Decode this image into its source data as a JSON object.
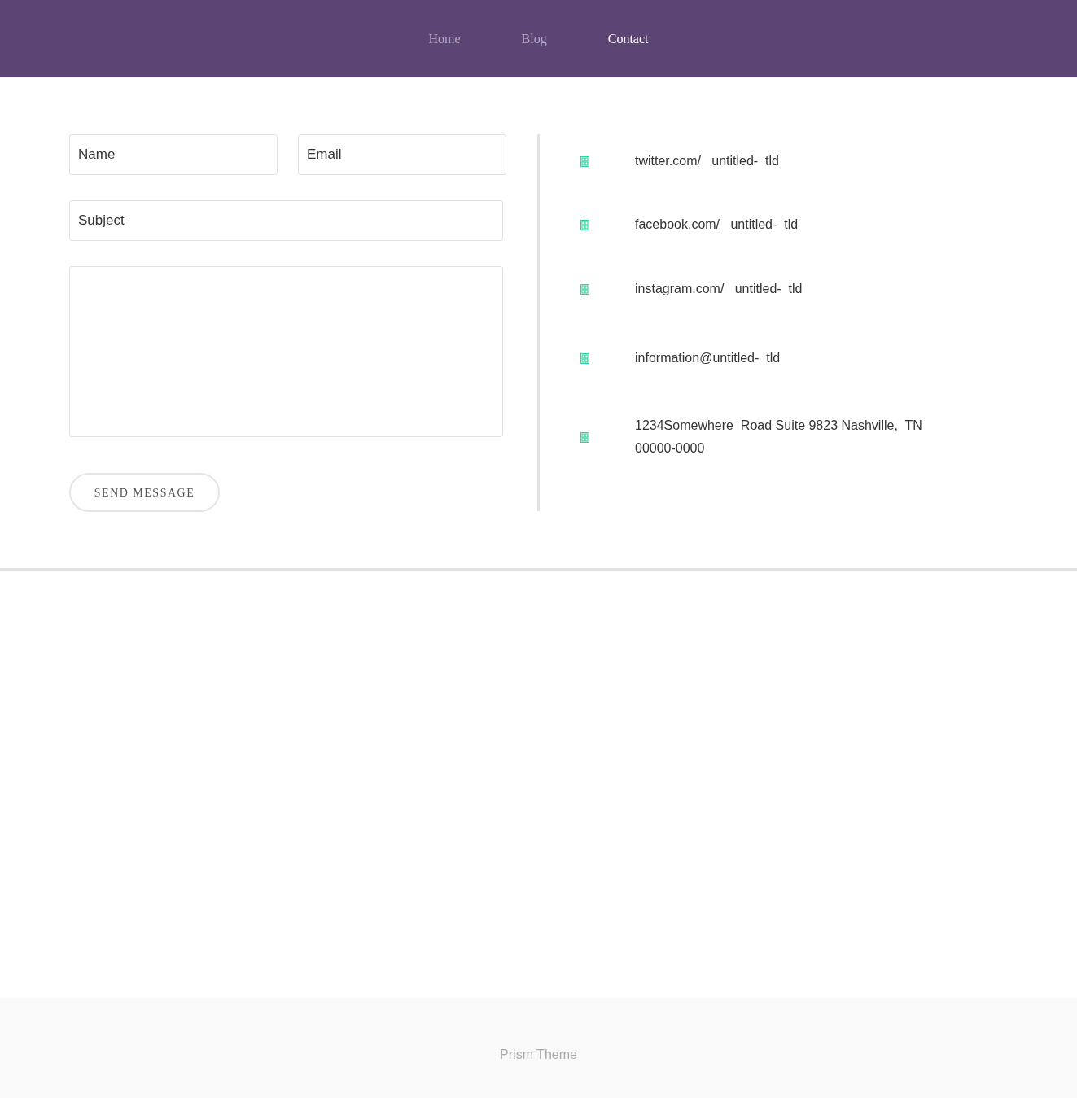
{
  "nav": [
    {
      "label": "Home",
      "selected": false
    },
    {
      "label": "Blog",
      "selected": false
    },
    {
      "label": "Contact",
      "selected": true
    }
  ],
  "form": {
    "name": {
      "placeholder": "Name"
    },
    "email": {
      "placeholder": "Email"
    },
    "subject": {
      "placeholder": "Subject"
    },
    "submit": "SEND MESSAGE"
  },
  "contacts": [
    {
      "lines": [
        "twitter.com/   untitled-  tld"
      ]
    },
    {
      "lines": [
        "facebook.com/   untitled-  tld"
      ]
    },
    {
      "lines": [
        "instagram.com/   untitled-  tld"
      ]
    },
    {
      "lines": [
        "information@untitled-  tld"
      ]
    },
    {
      "lines": [
        "1234Somewhere  Road Suite 9823 Nashville,  TN",
        "00000-0000"
      ]
    }
  ],
  "footer": {
    "text": "Prism Theme"
  }
}
